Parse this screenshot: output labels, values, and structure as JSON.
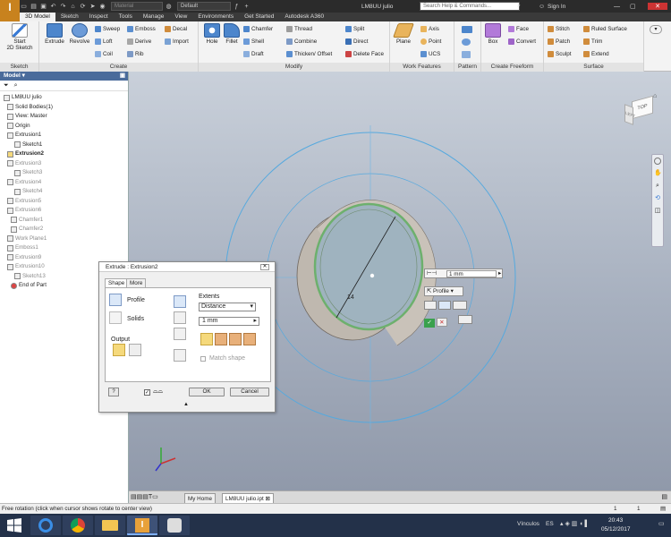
{
  "app": {
    "logo_letter": "I",
    "material_combo": "Material",
    "appearance_combo": "Default",
    "file_title": "LM8UU julio",
    "search_placeholder": "Search Help & Commands...",
    "sign_in": "Sign In"
  },
  "ribbon_tabs": [
    "3D Model",
    "Sketch",
    "Inspect",
    "Tools",
    "Manage",
    "View",
    "Environments",
    "Get Started",
    "Autodesk A360"
  ],
  "ribbon": {
    "sketch_panel": {
      "title": "Sketch",
      "start_sketch": "Start\n2D Sketch"
    },
    "create_panel": {
      "title": "Create",
      "extrude": "Extrude",
      "revolve": "Revolve",
      "sweep": "Sweep",
      "loft": "Loft",
      "coil": "Coil",
      "emboss": "Emboss",
      "derive": "Derive",
      "rib": "Rib",
      "decal": "Decal",
      "import": "Import"
    },
    "modify_panel": {
      "title": "Modify",
      "hole": "Hole",
      "fillet": "Fillet",
      "chamfer": "Chamfer",
      "shell": "Shell",
      "draft": "Draft",
      "thread": "Thread",
      "combine": "Combine",
      "thicken": "Thicken/ Offset",
      "split": "Split",
      "direct": "Direct",
      "delete_face": "Delete Face"
    },
    "work_panel": {
      "title": "Work Features",
      "plane": "Plane",
      "axis": "Axis",
      "point": "Point",
      "ucs": "UCS"
    },
    "pattern_panel": {
      "title": "Pattern"
    },
    "freeform_panel": {
      "title": "Create Freeform",
      "box": "Box",
      "face": "Face",
      "convert": "Convert"
    },
    "surface_panel": {
      "title": "Surface",
      "stitch": "Stitch",
      "patch": "Patch",
      "sculpt": "Sculpt",
      "ruled": "Ruled Surface",
      "trim": "Trim",
      "extend": "Extend"
    }
  },
  "browser": {
    "header": "Model",
    "items": [
      {
        "label": "LM8UU julio",
        "style": "normal"
      },
      {
        "label": "Solid Bodies(1)",
        "style": "normal"
      },
      {
        "label": "View: Master",
        "style": "normal"
      },
      {
        "label": "Origin",
        "style": "normal"
      },
      {
        "label": "Extrusion1",
        "style": "normal"
      },
      {
        "label": "Sketch1",
        "style": "normal"
      },
      {
        "label": "Extrusion2",
        "style": "bold"
      },
      {
        "label": "Extrusion3",
        "style": "dim"
      },
      {
        "label": "Sketch3",
        "style": "dim"
      },
      {
        "label": "Extrusion4",
        "style": "dim"
      },
      {
        "label": "Sketch4",
        "style": "dim"
      },
      {
        "label": "Extrusion5",
        "style": "dim"
      },
      {
        "label": "Extrusion6",
        "style": "dim"
      },
      {
        "label": "Chamfer1",
        "style": "dim"
      },
      {
        "label": "Chamfer2",
        "style": "dim"
      },
      {
        "label": "Work Plane1",
        "style": "dim"
      },
      {
        "label": "Emboss1",
        "style": "dim"
      },
      {
        "label": "Extrusion9",
        "style": "dim"
      },
      {
        "label": "Extrusion10",
        "style": "dim"
      },
      {
        "label": "Sketch13",
        "style": "dim"
      },
      {
        "label": "End of Part",
        "style": "normal"
      }
    ]
  },
  "viewport": {
    "viewcube_label": "TOP",
    "viewcube_side": "LEFT",
    "dimension_label": "14",
    "mini_distance": "1 mm",
    "mini_profile": "Profile"
  },
  "dialog": {
    "title": "Extrude : Extrusion2",
    "tab_shape": "Shape",
    "tab_more": "More",
    "profile": "Profile",
    "solids": "Solids",
    "output": "Output",
    "extents": "Extents",
    "extents_type": "Distance",
    "distance": "1 mm",
    "match_shape": "Match shape",
    "ok": "OK",
    "cancel": "Cancel"
  },
  "doc_tabs": [
    "My Home",
    "LM8UU julio.ipt"
  ],
  "status": {
    "message": "Free rotation (click when cursor shows rotate to center view)",
    "count_a": "1",
    "count_b": "1"
  },
  "taskbar": {
    "vinculos": "Vínculos",
    "lang": "ES",
    "time": "20:43",
    "date": "05/12/2017"
  }
}
